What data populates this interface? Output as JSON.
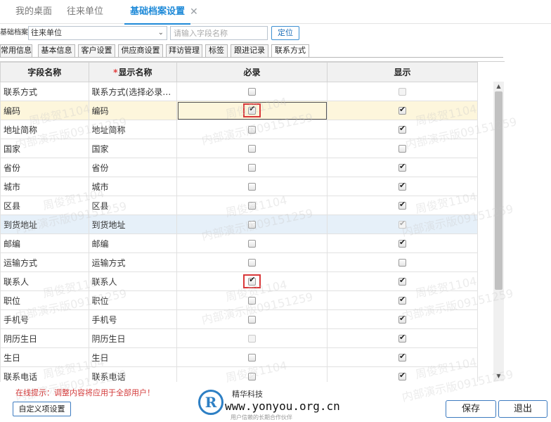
{
  "top_tabs": [
    {
      "label": "我的桌面",
      "active": false
    },
    {
      "label": "往来单位",
      "active": false
    },
    {
      "label": "基础档案设置",
      "active": true
    }
  ],
  "filter": {
    "archive_label": "基础档案",
    "archive_value": "往来单位",
    "search_placeholder": "请输入字段名称",
    "locate_label": "定位"
  },
  "sub_tabs": [
    {
      "label": "常用信息",
      "active": false
    },
    {
      "label": "基本信息",
      "active": false
    },
    {
      "label": "客户设置",
      "active": false
    },
    {
      "label": "供应商设置",
      "active": false
    },
    {
      "label": "拜访管理",
      "active": false
    },
    {
      "label": "标签",
      "active": false
    },
    {
      "label": "跟进记录",
      "active": false
    },
    {
      "label": "联系方式",
      "active": true
    }
  ],
  "grid": {
    "columns": {
      "field_name": "字段名称",
      "required_star": "*",
      "display_name": "显示名称",
      "required": "必录",
      "show": "显示"
    },
    "rows": [
      {
        "field": "联系方式",
        "display": "联系方式(选择必录…",
        "required": false,
        "required_disabled": false,
        "show": false,
        "show_disabled": true,
        "style": ""
      },
      {
        "field": "编码",
        "display": "编码",
        "required": true,
        "required_disabled": false,
        "show": true,
        "show_disabled": false,
        "style": "yellow",
        "highlight": true
      },
      {
        "field": "地址简称",
        "display": "地址简称",
        "required": false,
        "required_disabled": false,
        "show": true,
        "show_disabled": false,
        "style": ""
      },
      {
        "field": "国家",
        "display": "国家",
        "required": false,
        "required_disabled": false,
        "show": false,
        "show_disabled": false,
        "style": ""
      },
      {
        "field": "省份",
        "display": "省份",
        "required": false,
        "required_disabled": false,
        "show": true,
        "show_disabled": false,
        "style": ""
      },
      {
        "field": "城市",
        "display": "城市",
        "required": false,
        "required_disabled": false,
        "show": true,
        "show_disabled": false,
        "style": ""
      },
      {
        "field": "区县",
        "display": "区县",
        "required": false,
        "required_disabled": false,
        "show": true,
        "show_disabled": false,
        "style": ""
      },
      {
        "field": "到货地址",
        "display": "到货地址",
        "required": false,
        "required_disabled": false,
        "show": true,
        "show_disabled": true,
        "style": "blue"
      },
      {
        "field": "邮编",
        "display": "邮编",
        "required": false,
        "required_disabled": false,
        "show": true,
        "show_disabled": false,
        "style": ""
      },
      {
        "field": "运输方式",
        "display": "运输方式",
        "required": false,
        "required_disabled": false,
        "show": false,
        "show_disabled": false,
        "style": ""
      },
      {
        "field": "联系人",
        "display": "联系人",
        "required": true,
        "required_disabled": false,
        "show": true,
        "show_disabled": false,
        "style": "",
        "highlight": true
      },
      {
        "field": "职位",
        "display": "职位",
        "required": false,
        "required_disabled": false,
        "show": true,
        "show_disabled": false,
        "style": ""
      },
      {
        "field": "手机号",
        "display": "手机号",
        "required": false,
        "required_disabled": false,
        "show": true,
        "show_disabled": false,
        "style": ""
      },
      {
        "field": "阴历生日",
        "display": "阴历生日",
        "required": false,
        "required_disabled": true,
        "show": true,
        "show_disabled": false,
        "style": ""
      },
      {
        "field": "生日",
        "display": "生日",
        "required": false,
        "required_disabled": false,
        "show": true,
        "show_disabled": false,
        "style": ""
      },
      {
        "field": "联系电话",
        "display": "联系电话",
        "required": false,
        "required_disabled": false,
        "show": true,
        "show_disabled": false,
        "style": ""
      }
    ]
  },
  "footer": {
    "hint": "在线提示：调整内容将应用于全部用户！",
    "custom_label": "自定义项设置",
    "save_label": "保存",
    "exit_label": "退出"
  },
  "logo": {
    "cn_name": "精华科技",
    "url": "www.yonyou.org.cn",
    "slogan": "用户信赖的长期合作伙伴"
  },
  "watermark": {
    "line1": "周俊贺1104",
    "line2": "内部演示版09151259"
  },
  "colors": {
    "accent": "#1f8ad8",
    "highlight_box": "#d9383a",
    "row_yellow": "#fdf6dc",
    "row_blue": "#e6f0f9",
    "hint": "#d33b3b"
  }
}
